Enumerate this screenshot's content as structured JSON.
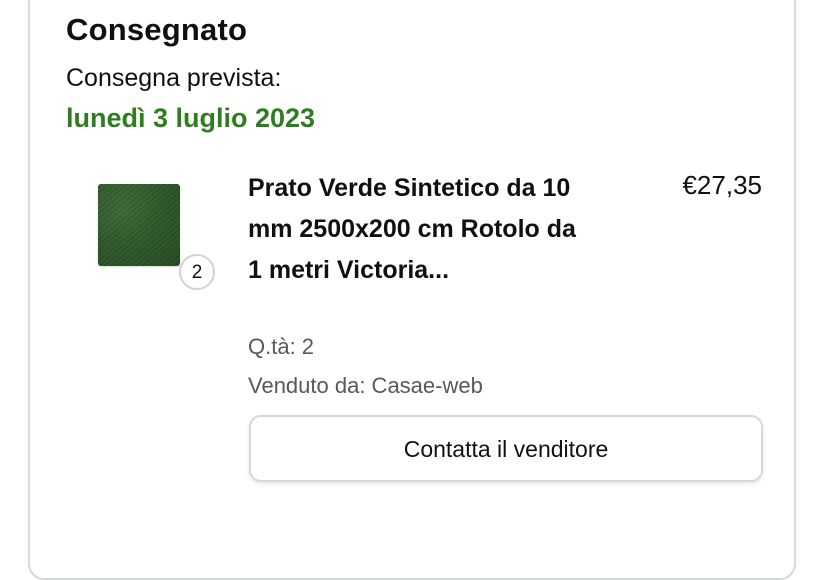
{
  "shipment": {
    "status": "Consegnato",
    "delivery_label": "Consegna prevista:",
    "delivery_date": "lunedì 3 luglio 2023"
  },
  "item": {
    "title": "Prato Verde Sintetico da 10 mm 2500x200 cm Rotolo da 1 metri Victoria...",
    "price": "€27,35",
    "quantity_badge": "2",
    "quantity_line": "Q.tà: 2",
    "seller_line": "Venduto da: Casae-web",
    "image_icon": "artificial-grass-product-image"
  },
  "actions": {
    "contact_seller_label": "Contatta il venditore"
  },
  "colors": {
    "delivery_date": "#2e7d1f",
    "secondary_text": "#565959",
    "border": "#d5d9d9"
  }
}
